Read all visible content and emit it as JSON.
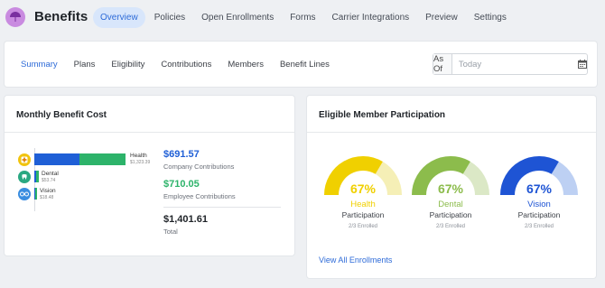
{
  "app": {
    "title": "Benefits",
    "logo_icon": "umbrella-icon"
  },
  "nav": {
    "items": [
      {
        "label": "Overview",
        "active": true
      },
      {
        "label": "Policies"
      },
      {
        "label": "Open Enrollments"
      },
      {
        "label": "Forms"
      },
      {
        "label": "Carrier Integrations"
      },
      {
        "label": "Preview"
      },
      {
        "label": "Settings"
      }
    ]
  },
  "subnav": {
    "items": [
      {
        "label": "Summary",
        "active": true
      },
      {
        "label": "Plans"
      },
      {
        "label": "Eligibility"
      },
      {
        "label": "Contributions"
      },
      {
        "label": "Members"
      },
      {
        "label": "Benefit Lines"
      }
    ],
    "as_of_label": "As Of",
    "date_placeholder": "Today"
  },
  "cost": {
    "title": "Monthly Benefit Cost",
    "lines": [
      {
        "name": "Health",
        "amount": "$1,323.39",
        "icon": "health-icon",
        "color": "#f1c40f"
      },
      {
        "name": "Dental",
        "amount": "$53.74",
        "icon": "tooth-icon",
        "color": "#2aa882"
      },
      {
        "name": "Vision",
        "amount": "$18.48",
        "icon": "glasses-icon",
        "color": "#3a8de0"
      }
    ],
    "company_value": "$691.57",
    "company_label": "Company Contributions",
    "employee_value": "$710.05",
    "employee_label": "Employee Contributions",
    "total_value": "$1,401.61",
    "total_label": "Total",
    "colors": {
      "company": "#1f5fd6",
      "employee": "#2db36a"
    }
  },
  "participation": {
    "title": "Eligible Member Participation",
    "gauges": [
      {
        "name": "Health",
        "percent": "67%",
        "fraction": 0.67,
        "sub": "Participation",
        "enrolled": "2/3 Enrolled",
        "color": "#f0d000",
        "track": "#f5efb6"
      },
      {
        "name": "Dental",
        "percent": "67%",
        "fraction": 0.67,
        "sub": "Participation",
        "enrolled": "2/3 Enrolled",
        "color": "#8cbc4c",
        "track": "#dbe8c6"
      },
      {
        "name": "Vision",
        "percent": "67%",
        "fraction": 0.67,
        "sub": "Participation",
        "enrolled": "2/3 Enrolled",
        "color": "#1e54d4",
        "track": "#bdd0f3"
      }
    ],
    "view_all": "View All Enrollments"
  }
}
